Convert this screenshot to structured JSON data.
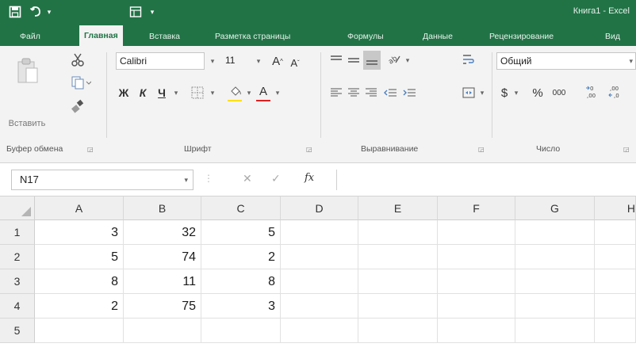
{
  "title_bar": {
    "window_title": "Книга1 - Excel",
    "qat_icons": [
      "save-icon",
      "undo-icon",
      "form-icon"
    ],
    "qat_dropdown": "▾"
  },
  "ribbon_tabs": [
    "Файл",
    "Главная",
    "Вставка",
    "Разметка страницы",
    "Формулы",
    "Данные",
    "Рецензирование",
    "Вид"
  ],
  "active_tab": "Главная",
  "clipboard": {
    "paste_label": "Вставить",
    "group_label": "Буфер обмена"
  },
  "font": {
    "name": "Calibri",
    "size": "11",
    "bold": "Ж",
    "italic": "К",
    "underline": "Ч",
    "grow": "A",
    "shrink": "A",
    "font_color_letter": "A",
    "group_label": "Шрифт"
  },
  "alignment": {
    "group_label": "Выравнивание"
  },
  "number": {
    "format": "Общий",
    "currency": "$",
    "percent": "%",
    "thousands": "000",
    "group_label": "Число"
  },
  "formula_bar": {
    "name_box": "N17",
    "cancel": "✕",
    "enter": "✓",
    "fx": "fx",
    "content": ""
  },
  "sheet": {
    "columns": [
      "A",
      "B",
      "C",
      "D",
      "E",
      "F",
      "G",
      "H"
    ],
    "rows": [
      "1",
      "2",
      "3",
      "4",
      "5"
    ],
    "cells": [
      [
        "3",
        "32",
        "5",
        "",
        "",
        "",
        "",
        ""
      ],
      [
        "5",
        "74",
        "2",
        "",
        "",
        "",
        "",
        ""
      ],
      [
        "8",
        "11",
        "8",
        "",
        "",
        "",
        "",
        ""
      ],
      [
        "2",
        "75",
        "3",
        "",
        "",
        "",
        "",
        ""
      ],
      [
        "",
        "",
        "",
        "",
        "",
        "",
        "",
        ""
      ]
    ]
  },
  "colors": {
    "excel_green": "#217346",
    "font_color_bar": "#e02020",
    "highlight_bar": "#ffe000"
  }
}
